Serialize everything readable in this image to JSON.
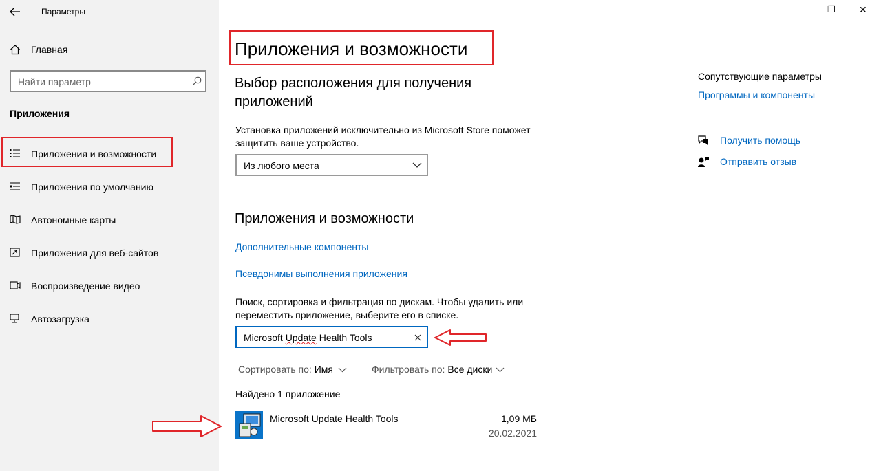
{
  "window": {
    "title": "Параметры",
    "controls": {
      "minimize": "—",
      "restore": "❐",
      "close": "✕"
    }
  },
  "sidebar": {
    "home": "Главная",
    "search_placeholder": "Найти параметр",
    "section": "Приложения",
    "items": [
      {
        "label": "Приложения и возможности",
        "icon": "list-icon"
      },
      {
        "label": "Приложения по умолчанию",
        "icon": "list-default-icon"
      },
      {
        "label": "Автономные карты",
        "icon": "map-icon"
      },
      {
        "label": "Приложения для веб-сайтов",
        "icon": "web-app-icon"
      },
      {
        "label": "Воспроизведение видео",
        "icon": "video-icon"
      },
      {
        "label": "Автозагрузка",
        "icon": "startup-icon"
      }
    ]
  },
  "main": {
    "page_title": "Приложения и возможности",
    "location_heading": "Выбор расположения для получения приложений",
    "location_heading_line1": "Выбор расположения для получения",
    "location_heading_line2": "приложений",
    "location_desc_line1": "Установка приложений исключительно из Microsoft Store поможет",
    "location_desc_line2": "защитить ваше устройство.",
    "location_dropdown_value": "Из любого места",
    "apps_heading": "Приложения и возможности",
    "link_optional": "Дополнительные компоненты",
    "link_aliases": "Псевдонимы выполнения приложения",
    "search_desc_line1": "Поиск, сортировка и фильтрация по дискам. Чтобы удалить или",
    "search_desc_line2": "переместить приложение, выберите его в списке.",
    "search_value_part1": "Microsoft ",
    "search_value_part2": "Update",
    "search_value_part3": " Health Tools",
    "sort_label": "Сортировать по:",
    "sort_value": "Имя",
    "filter_label": "Фильтровать по:",
    "filter_value": "Все диски",
    "found_text": "Найдено 1 приложение",
    "app": {
      "name": "Microsoft Update Health Tools",
      "size": "1,09 МБ",
      "date": "20.02.2021"
    }
  },
  "related": {
    "heading": "Сопутствующие параметры",
    "programs_link": "Программы и компоненты",
    "help": "Получить помощь",
    "feedback": "Отправить отзыв"
  },
  "colors": {
    "accent": "#0067c0",
    "annotation_red": "#e0262a",
    "sidebar_bg": "#f2f2f2"
  }
}
